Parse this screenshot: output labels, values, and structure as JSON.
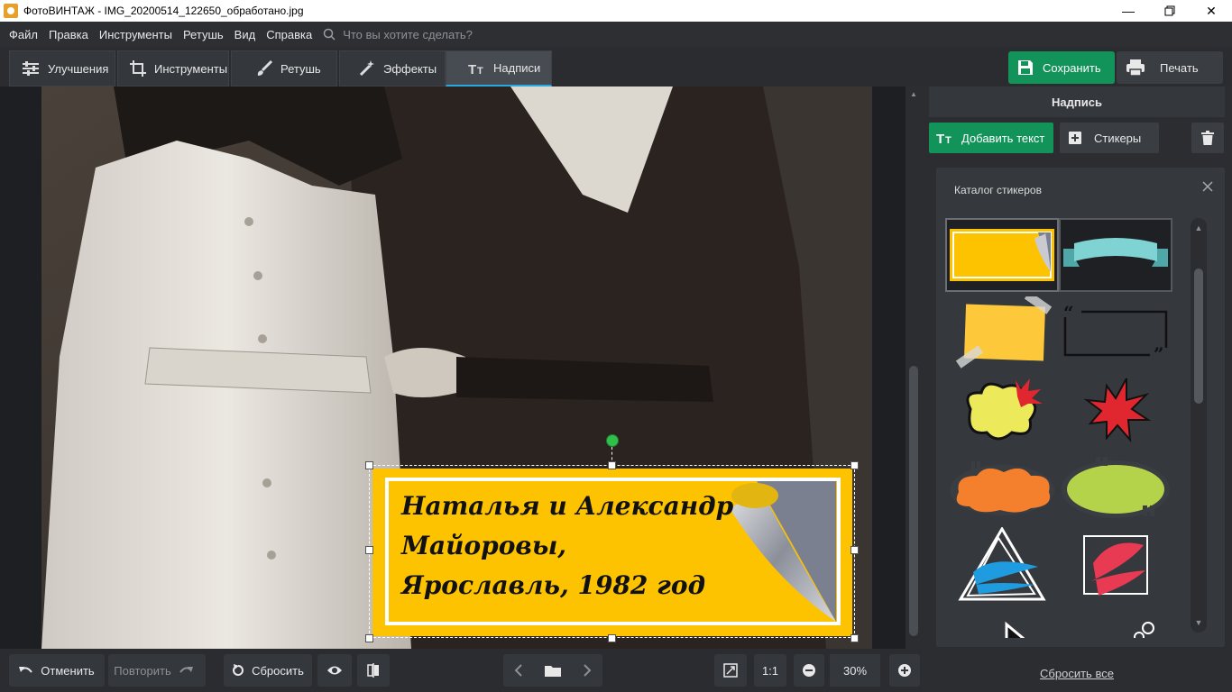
{
  "window": {
    "title": "ФотоВИНТАЖ - IMG_20200514_122650_обработано.jpg",
    "controls": [
      "minimize-icon",
      "restore-icon",
      "close-icon"
    ]
  },
  "menu": {
    "items": [
      "Файл",
      "Правка",
      "Инструменты",
      "Ретушь",
      "Вид",
      "Справка"
    ],
    "search_placeholder": "Что вы хотите сделать?"
  },
  "toolbar": {
    "tabs": [
      {
        "label": "Улучшения",
        "icon": "sliders-icon"
      },
      {
        "label": "Инструменты",
        "icon": "crop-icon"
      },
      {
        "label": "Ретушь",
        "icon": "brush-icon"
      },
      {
        "label": "Эффекты",
        "icon": "magic-wand-icon"
      },
      {
        "label": "Надписи",
        "icon": "text-icon",
        "active": true
      }
    ],
    "save_label": "Сохранить",
    "print_label": "Печать"
  },
  "canvas": {
    "sticker_text": "Наталья и Александр\nМайоровы,\nЯрославль, 1982 год",
    "sticker_color": "#fdc300"
  },
  "right_panel": {
    "header": "Надпись",
    "add_text_label": "Добавить текст",
    "stickers_label": "Стикеры",
    "catalog_title": "Каталог стикеров",
    "stickers": [
      "yellow-page-curl",
      "teal-ribbon",
      "yellow-taped-note",
      "quote-frame",
      "yellow-burst-bubble",
      "red-explosion",
      "orange-speech-bubble",
      "green-speech-bubble",
      "blue-triangle-scribble",
      "red-square-scribble",
      "black-arrow",
      "black-thought-bubble"
    ],
    "reset_all_label": "Сбросить все"
  },
  "bottom": {
    "undo_label": "Отменить",
    "redo_label": "Повторить",
    "reset_label": "Сбросить",
    "ratio_label": "1:1",
    "zoom_value": "30%"
  },
  "colors": {
    "accent_green": "#12935a",
    "active_tab_border": "#2aa8e0"
  }
}
